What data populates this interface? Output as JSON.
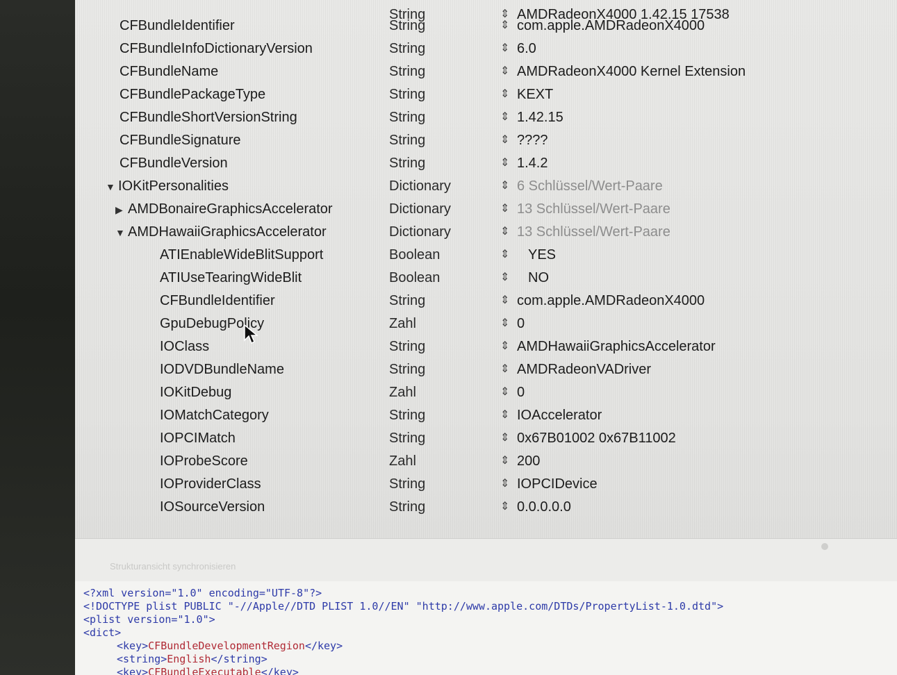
{
  "rows": [
    {
      "key": "",
      "type": "String",
      "value": "AMDRadeonX4000 1.42.15 17538",
      "level": 0,
      "disclosure": "",
      "muted": false
    },
    {
      "key": "CFBundleIdentifier",
      "type": "String",
      "value": "com.apple.AMDRadeonX4000",
      "level": 0,
      "disclosure": "",
      "muted": false
    },
    {
      "key": "CFBundleInfoDictionaryVersion",
      "type": "String",
      "value": "6.0",
      "level": 0,
      "disclosure": "",
      "muted": false
    },
    {
      "key": "CFBundleName",
      "type": "String",
      "value": "AMDRadeonX4000 Kernel Extension",
      "level": 0,
      "disclosure": "",
      "muted": false
    },
    {
      "key": "CFBundlePackageType",
      "type": "String",
      "value": "KEXT",
      "level": 0,
      "disclosure": "",
      "muted": false
    },
    {
      "key": "CFBundleShortVersionString",
      "type": "String",
      "value": "1.42.15",
      "level": 0,
      "disclosure": "",
      "muted": false
    },
    {
      "key": "CFBundleSignature",
      "type": "String",
      "value": "????",
      "level": 0,
      "disclosure": "",
      "muted": false
    },
    {
      "key": "CFBundleVersion",
      "type": "String",
      "value": "1.4.2",
      "level": 0,
      "disclosure": "",
      "muted": false
    },
    {
      "key": "IOKitPersonalities",
      "type": "Dictionary",
      "value": "6 Schlüssel/Wert-Paare",
      "level": 0,
      "disclosure": "▼",
      "muted": true
    },
    {
      "key": "AMDBonaireGraphicsAccelerator",
      "type": "Dictionary",
      "value": "13 Schlüssel/Wert-Paare",
      "level": 1,
      "disclosure": "▶",
      "muted": true
    },
    {
      "key": "AMDHawaiiGraphicsAccelerator",
      "type": "Dictionary",
      "value": "13 Schlüssel/Wert-Paare",
      "level": 1,
      "disclosure": "▼",
      "muted": true
    },
    {
      "key": "ATIEnableWideBlitSupport",
      "type": "Boolean",
      "value": "YES",
      "level": 2,
      "disclosure": "",
      "muted": false
    },
    {
      "key": "ATIUseTearingWideBlit",
      "type": "Boolean",
      "value": "NO",
      "level": 2,
      "disclosure": "",
      "muted": false
    },
    {
      "key": "CFBundleIdentifier",
      "type": "String",
      "value": "com.apple.AMDRadeonX4000",
      "level": 2,
      "disclosure": "",
      "muted": false
    },
    {
      "key": "GpuDebugPolicy",
      "type": "Zahl",
      "value": "0",
      "level": 2,
      "disclosure": "",
      "muted": false
    },
    {
      "key": "IOClass",
      "type": "String",
      "value": "AMDHawaiiGraphicsAccelerator",
      "level": 2,
      "disclosure": "",
      "muted": false
    },
    {
      "key": "IODVDBundleName",
      "type": "String",
      "value": "AMDRadeonVADriver",
      "level": 2,
      "disclosure": "",
      "muted": false
    },
    {
      "key": "IOKitDebug",
      "type": "Zahl",
      "value": "0",
      "level": 2,
      "disclosure": "",
      "muted": false
    },
    {
      "key": "IOMatchCategory",
      "type": "String",
      "value": "IOAccelerator",
      "level": 2,
      "disclosure": "",
      "muted": false
    },
    {
      "key": "IOPCIMatch",
      "type": "String",
      "value": "0x67B01002 0x67B11002",
      "level": 2,
      "disclosure": "",
      "muted": false
    },
    {
      "key": "IOProbeScore",
      "type": "Zahl",
      "value": "200",
      "level": 2,
      "disclosure": "",
      "muted": false
    },
    {
      "key": "IOProviderClass",
      "type": "String",
      "value": "IOPCIDevice",
      "level": 2,
      "disclosure": "",
      "muted": false
    },
    {
      "key": "IOSourceVersion",
      "type": "String",
      "value": "0.0.0.0.0",
      "level": 2,
      "disclosure": "",
      "muted": false
    }
  ],
  "stepper_glyph": "⇕",
  "structure_label": "Strukturansicht synchronisieren",
  "xml": {
    "line1": "<?xml version=\"1.0\" encoding=\"UTF-8\"?>",
    "line2": "<!DOCTYPE plist PUBLIC \"-//Apple//DTD PLIST 1.0//EN\" \"http://www.apple.com/DTDs/PropertyList-1.0.dtd\">",
    "line3": "<plist version=\"1.0\">",
    "line4": "<dict>",
    "line5_open": "<key>",
    "line5_text": "CFBundleDevelopmentRegion",
    "line5_close": "</key>",
    "line6_open": "<string>",
    "line6_text": "English",
    "line6_close": "</string>",
    "line7_open": "<key>",
    "line7_text": "CFBundleExecutable",
    "line7_close": "</key>"
  },
  "colors": {
    "tag": "#2d3aa8",
    "content": "#b02a35",
    "muted": "#8d8d8d"
  },
  "icons": {
    "disclosure_open": "triangle-down-icon",
    "disclosure_closed": "triangle-right-icon",
    "stepper": "updown-stepper-icon",
    "cursor": "mouse-pointer-icon"
  }
}
